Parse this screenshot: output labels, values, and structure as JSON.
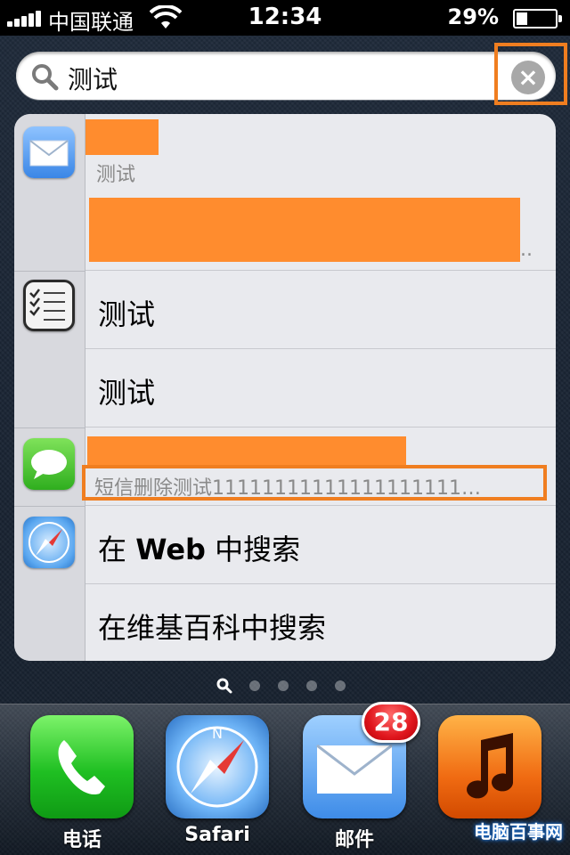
{
  "status_bar": {
    "carrier": "中国联通",
    "time": "12:34",
    "battery_percent": "29%",
    "battery_level": 0.29
  },
  "search": {
    "query": "测试",
    "clear_symbol": "×"
  },
  "results": {
    "mail": {
      "icon": "mail-icon",
      "subtitle": "测试",
      "ellipsis": ".."
    },
    "notes": {
      "icon": "notes-icon",
      "items": [
        "测试",
        "测试"
      ]
    },
    "messages": {
      "icon": "messages-icon",
      "preview": "短信删除测试11111111111111111111…"
    },
    "web": {
      "icon": "safari-icon",
      "search_web_prefix": "在 ",
      "search_web_bold": "Web",
      "search_web_suffix": " 中搜索",
      "search_wiki": "在维基百科中搜索"
    }
  },
  "page_indicator": {
    "pages": 4,
    "current": 0,
    "search_page_icon": "search-icon"
  },
  "dock": [
    {
      "label": "电话",
      "icon": "phone-icon"
    },
    {
      "label": "Safari",
      "icon": "safari-icon"
    },
    {
      "label": "邮件",
      "icon": "mail-icon",
      "badge": "28"
    },
    {
      "label": "",
      "icon": "music-icon"
    }
  ],
  "watermark": "电脑百事网"
}
